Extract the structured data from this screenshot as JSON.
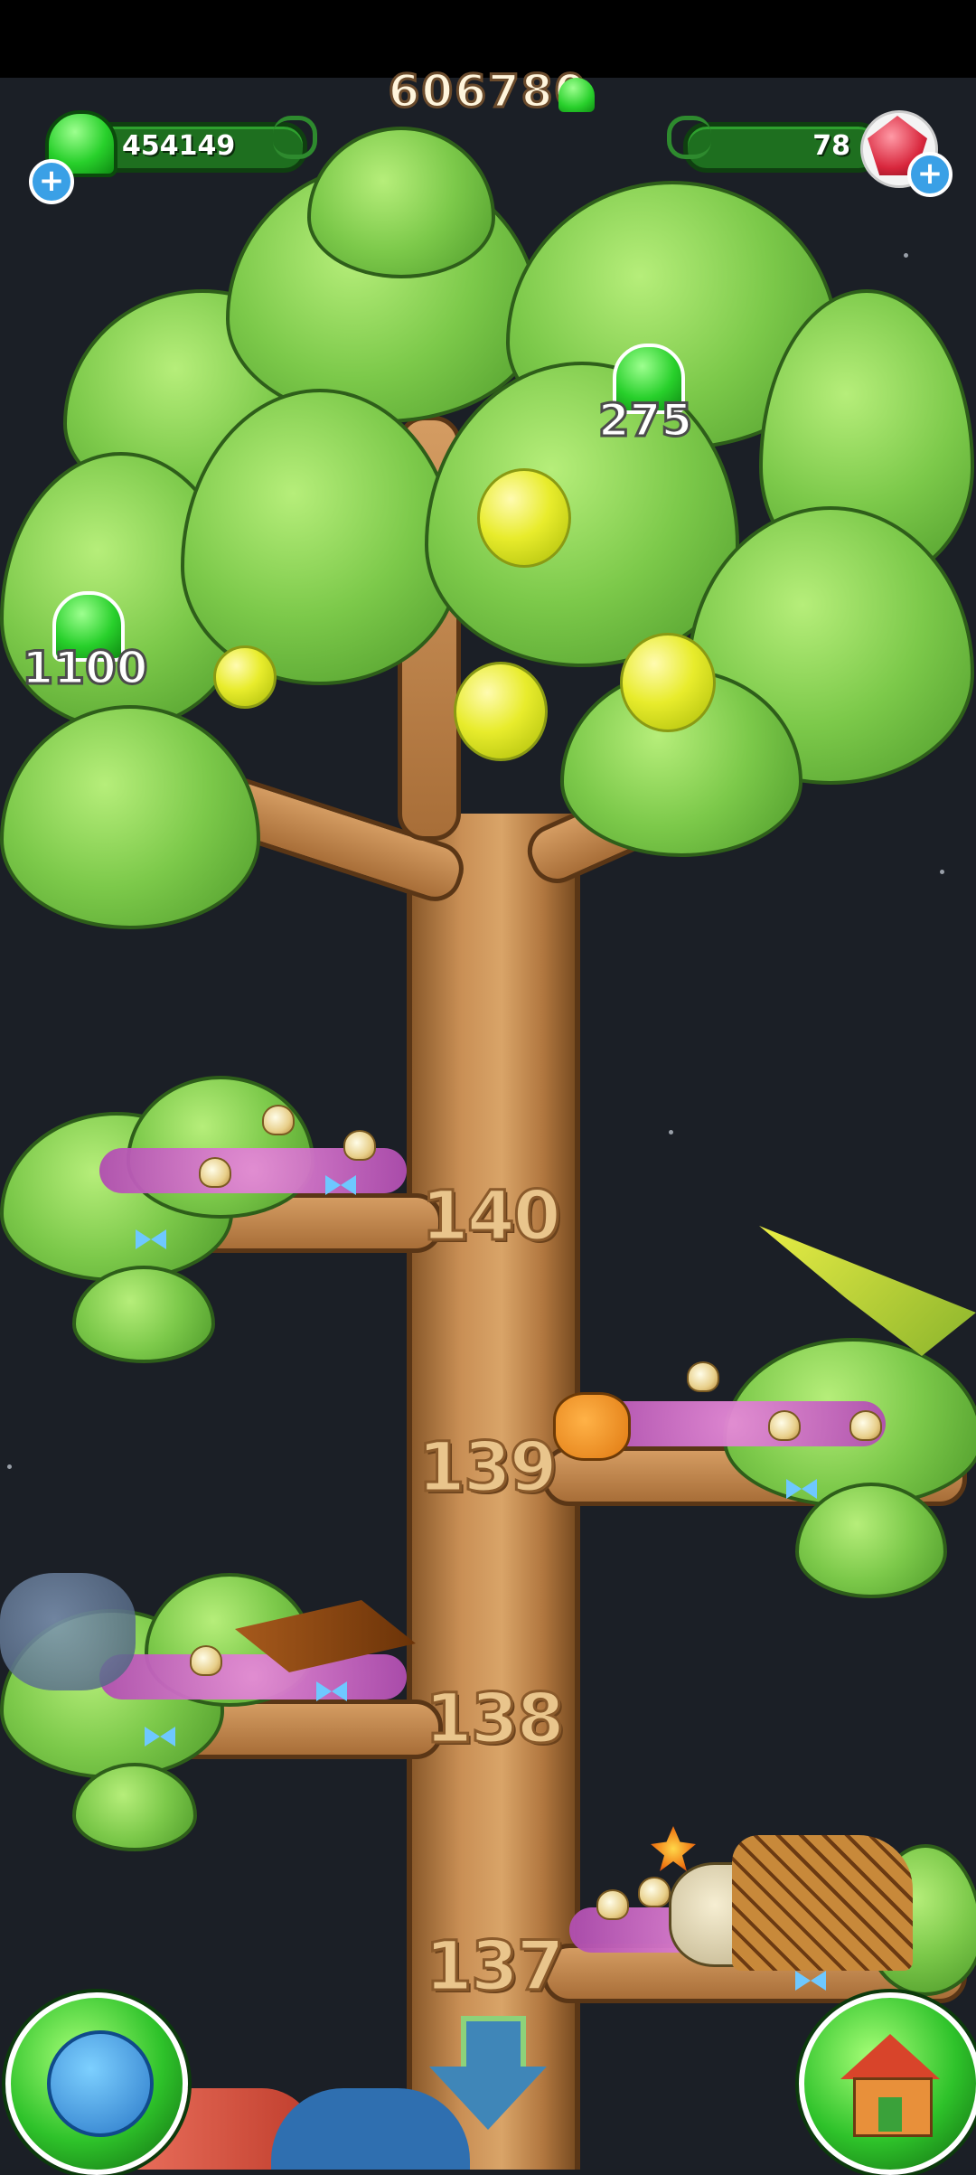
{
  "hud": {
    "total_score": "606780",
    "green_currency": "454149",
    "red_currency": "78",
    "green_plus_icon": "plus-icon",
    "red_plus_icon": "plus-icon"
  },
  "tree": {
    "drops": [
      {
        "amount": "275"
      },
      {
        "amount": "1100"
      }
    ],
    "levels": [
      {
        "number": "140"
      },
      {
        "number": "139"
      },
      {
        "number": "138"
      },
      {
        "number": "137"
      }
    ]
  },
  "buttons": {
    "globe_icon": "globe-icon",
    "scroll_down_icon": "arrow-down-icon",
    "home_icon": "house-icon"
  },
  "colors": {
    "currency_bar": "#1e6f1f",
    "gem_green": "#28d02b",
    "ruby_red": "#d8263c",
    "trunk": "#c98f55",
    "leaf": "#7cc94a"
  }
}
